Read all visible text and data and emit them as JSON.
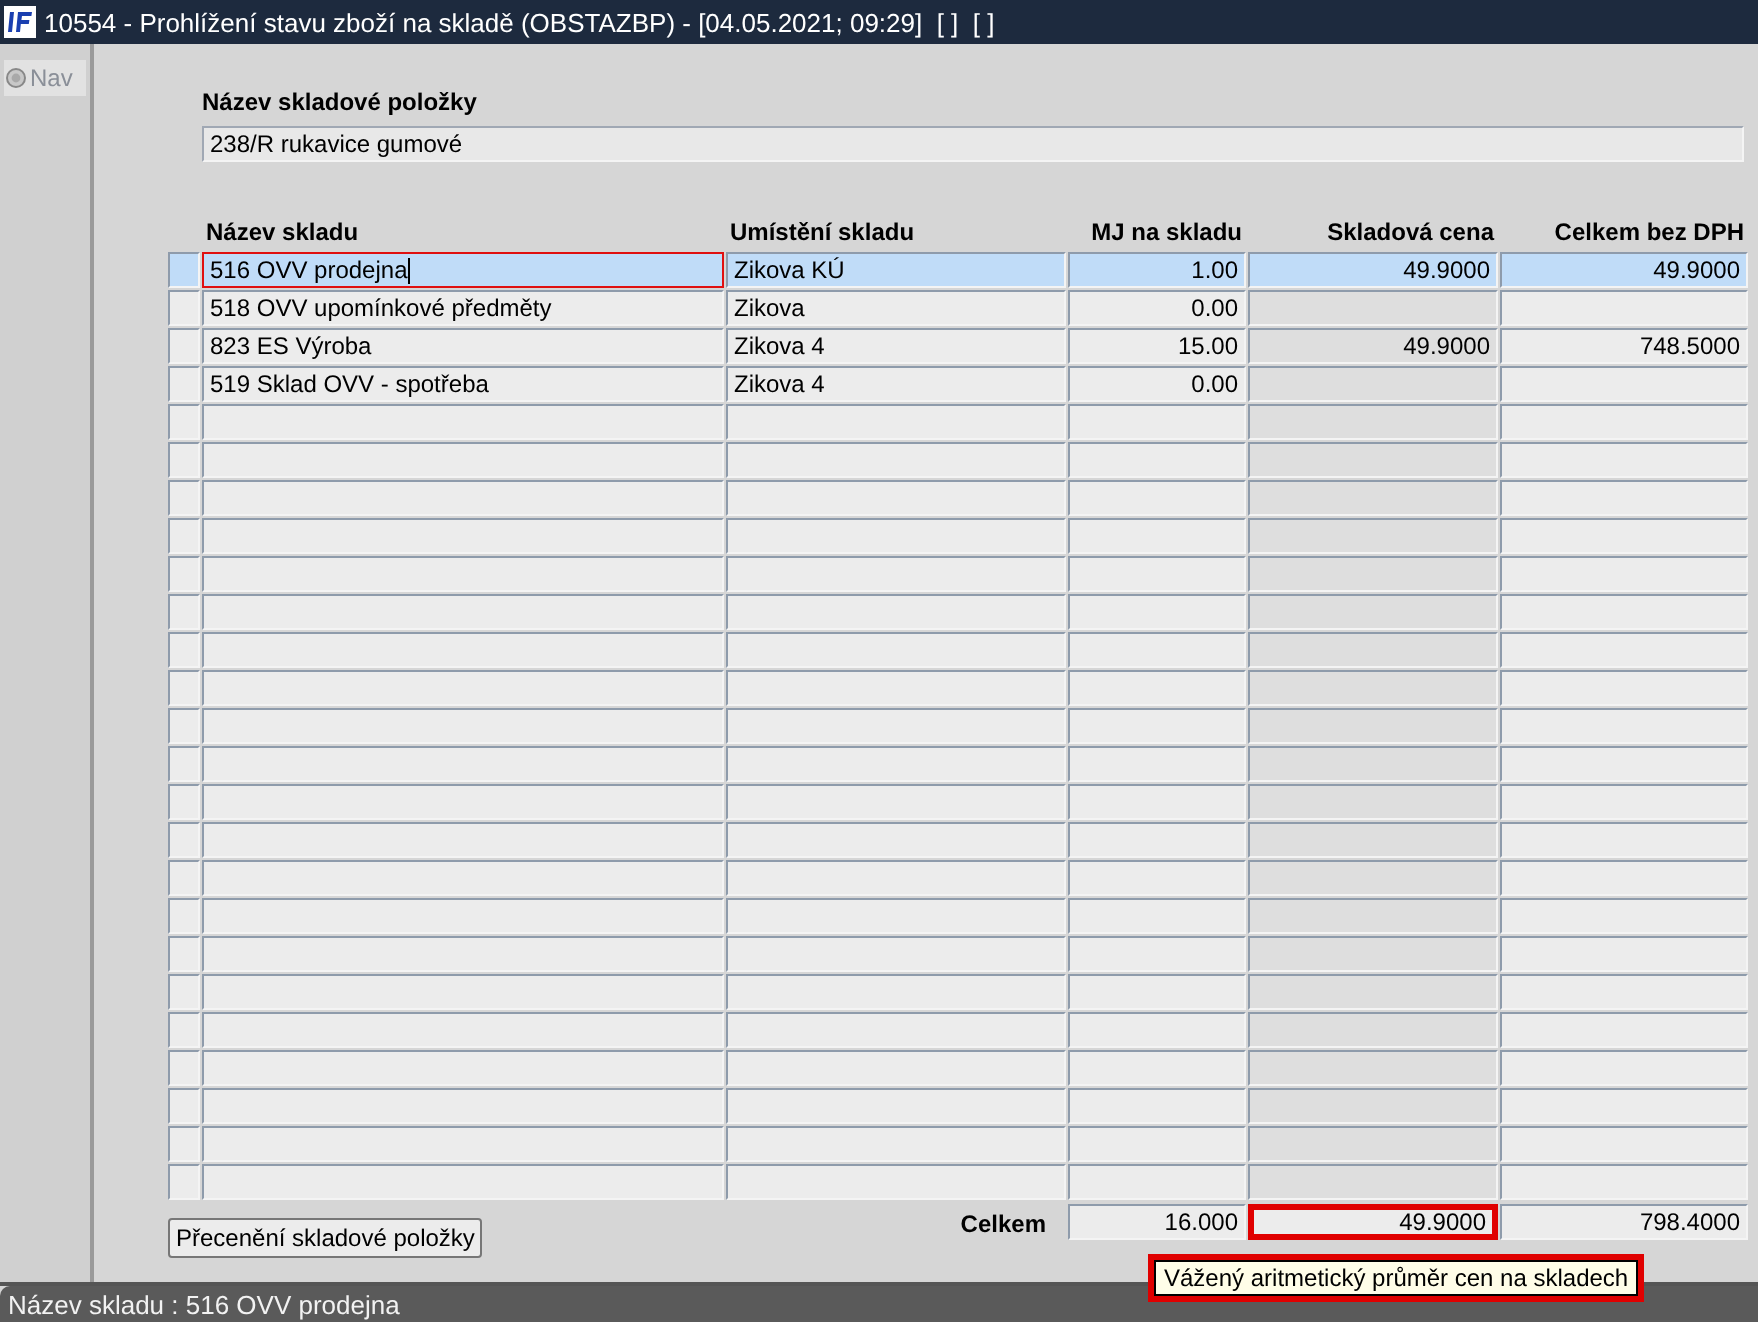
{
  "window": {
    "title": "10554 - Prohlížení stavu zboží na skladě (OBSTAZBP) - [04.05.2021; 09:29]  [ ]  [ ]"
  },
  "nav": {
    "label": "Nav",
    "disabled": true
  },
  "item": {
    "label": "Název skladové položky",
    "value": "238/R rukavice gumové"
  },
  "table": {
    "columns": [
      "Název skladu",
      "Umístění skladu",
      "MJ na skladu",
      "Skladová cena",
      "Celkem bez DPH"
    ],
    "rows": [
      {
        "name": "516 OVV prodejna",
        "location": "Zikova KÚ",
        "quantity": "1.00",
        "price": "49.9000",
        "total": "49.9000",
        "selected": true
      },
      {
        "name": "518 OVV upomínkové předměty",
        "location": "Zikova",
        "quantity": "0.00",
        "selected": false
      },
      {
        "name": "823 ES Výroba",
        "location": "Zikova 4",
        "quantity": "15.00",
        "price": "49.9000",
        "total": "748.5000",
        "selected": false
      },
      {
        "name": "519 Sklad OVV - spotřeba",
        "location": "Zikova 4",
        "quantity": "0.00",
        "selected": false
      }
    ]
  },
  "totals": {
    "label": "Celkem",
    "quantity": "16.000",
    "price": "49.9000",
    "total": "798.4000",
    "price_highlighted": true
  },
  "reprice_button": "Přecenění skladové položky",
  "tooltip": "Vážený aritmetický průměr cen na skladech",
  "status_bar": "Název skladu : 516 OVV prodejna"
}
